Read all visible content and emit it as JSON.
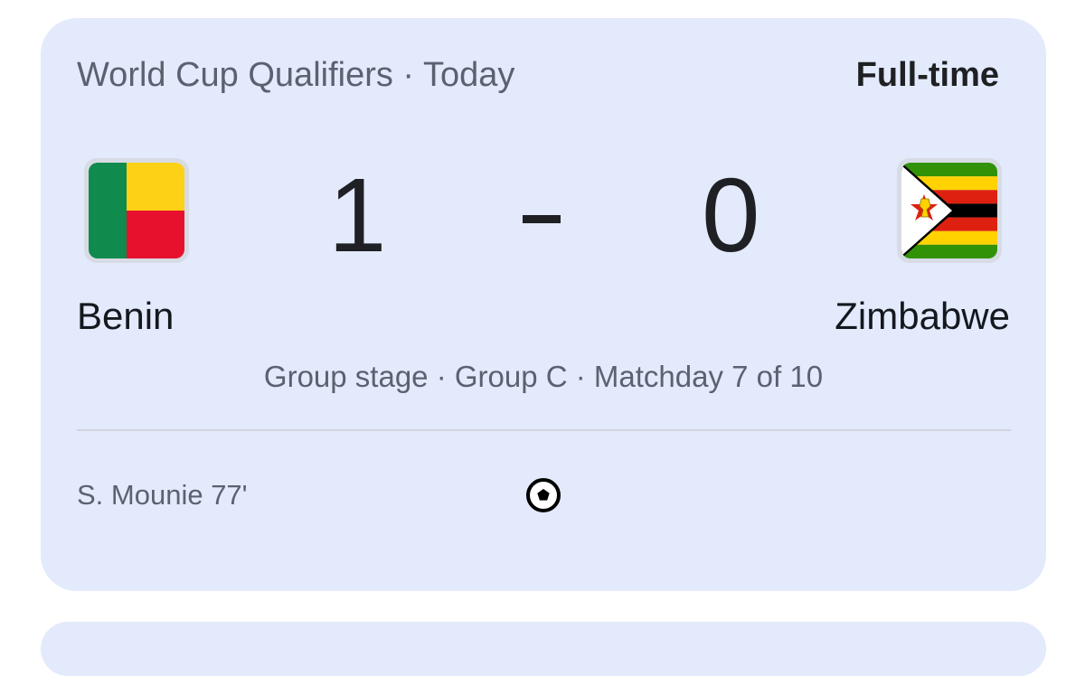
{
  "match": {
    "competition_line": "World Cup Qualifiers · Today",
    "status": "Full-time",
    "home": {
      "name": "Benin",
      "score": "1",
      "flag_icon": "benin-flag"
    },
    "away": {
      "name": "Zimbabwe",
      "score": "0",
      "flag_icon": "zimbabwe-flag"
    },
    "stage_line": "Group stage · Group C · Matchday 7 of 10",
    "goals": [
      {
        "scorer": "S. Mounie 77'",
        "icon": "soccer-ball-icon"
      }
    ]
  },
  "colors": {
    "card_background": "#e3eafb",
    "benin_green": "#108a4d",
    "benin_yellow": "#fcd116",
    "benin_red": "#e8112d",
    "zimbabwe_green": "#319208",
    "zimbabwe_yellow": "#ffd200",
    "zimbabwe_red": "#de2010",
    "zimbabwe_black": "#000000"
  }
}
